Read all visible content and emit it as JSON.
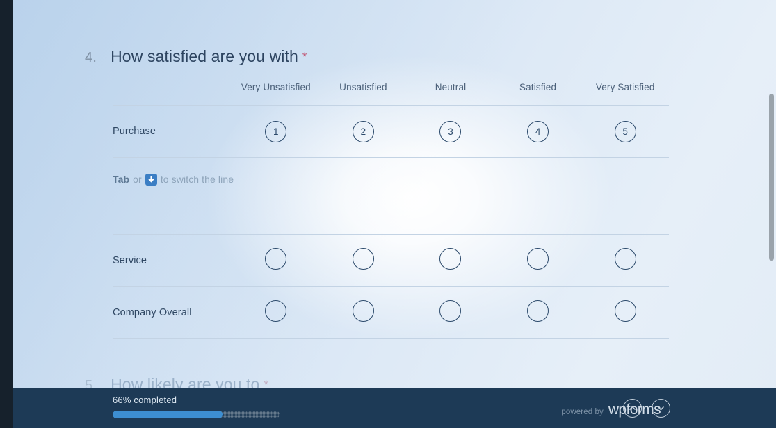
{
  "question": {
    "number": "4.",
    "title": "How satisfied are you with",
    "required_mark": "*"
  },
  "likert": {
    "row_header_label": "",
    "columns": [
      "Very Unsatisfied",
      "Unsatisfied",
      "Neutral",
      "Satisfied",
      "Very Satisfied"
    ],
    "rows": [
      {
        "label": "Purchase",
        "options": [
          "1",
          "2",
          "3",
          "4",
          "5"
        ],
        "show_numbers": true
      },
      {
        "label": "Service",
        "options": [
          "",
          "",
          "",
          "",
          ""
        ],
        "show_numbers": false
      },
      {
        "label": "Company Overall",
        "options": [
          "",
          "",
          "",
          "",
          ""
        ],
        "show_numbers": false
      }
    ],
    "hint": {
      "key_label": "Tab",
      "conjunction": "or",
      "arrow_icon": "arrow-down-icon",
      "suffix": "to switch the line"
    }
  },
  "next_question": {
    "number": "5.",
    "title": "How likely are you to",
    "required_mark": "*"
  },
  "footer": {
    "progress_label": "66% completed",
    "progress_percent": 66,
    "brand_prefix": "powered by",
    "brand_name": "wpforms",
    "nav_up_icon": "chevron-up-icon",
    "nav_down_icon": "chevron-down-icon"
  },
  "colors": {
    "accent_blue": "#3d8ed1",
    "footer_bg": "#1d3a56",
    "required_asterisk": "#c0506f",
    "circle_border": "#2c4a6b",
    "title_text": "#2d4460"
  }
}
